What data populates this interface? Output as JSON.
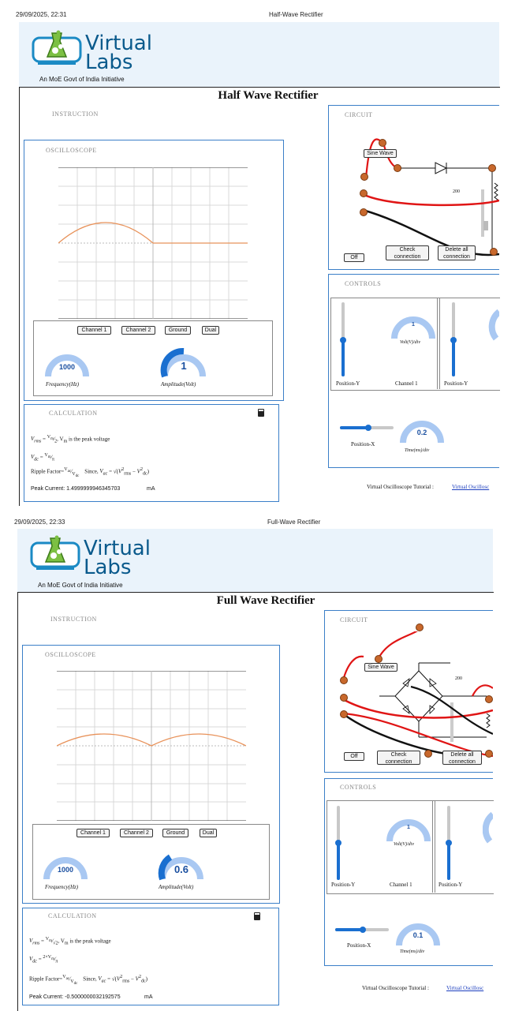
{
  "pages": [
    {
      "header_datetime": "29/09/2025, 22:31",
      "header_title": "Half-Wave Rectifier",
      "logo_line1": "Virtual",
      "logo_line2": "Labs",
      "logo_sub": "An MoE Govt of India Initiative",
      "title": "Half Wave Rectifier",
      "instruction_label": "INSTRUCTION",
      "oscilloscope_label": "OSCILLOSCOPE",
      "channel_buttons": [
        "Channel 1",
        "Channel 2",
        "Ground",
        "Dual"
      ],
      "frequency_value": "1000",
      "frequency_label": "Frequency(Hz)",
      "amplitude_value": "1",
      "amplitude_label": "Amplitude(Volt)",
      "calculation_label": "CALCULATION",
      "vrms_text": ", V",
      "vrms_suffix": " is the peak voltage",
      "ripple_label": "Ripple Factor=",
      "since_text": "Since,",
      "peak_current_label": "Peak Current: 1.4999999946345703",
      "peak_current_unit": "mA",
      "circuit_label": "CIRCUIT",
      "sine_wave_label": "Sine Wave",
      "resistor_value": "200",
      "off_button": "Off",
      "check_button": "Check connection",
      "delete_button": "Delete all connection",
      "controls_label": "CONTROLS",
      "volt_div_value": "1",
      "volt_div_label": "Volt(V)/div",
      "position_y_label": "Position-Y",
      "channel1_label": "Channel 1",
      "position_y2_label": "Position-Y",
      "time_div_value": "0.2",
      "time_div_label": "Time(ms)/div",
      "position_x_label": "Position-X",
      "tutorial_text": "Virtual Oscilloscope Tutorial :",
      "tutorial_link": "Virtual Oscillosc"
    },
    {
      "header_datetime": "29/09/2025, 22:33",
      "header_title": "Full-Wave Rectifier",
      "logo_line1": "Virtual",
      "logo_line2": "Labs",
      "logo_sub": "An MoE Govt of India Initiative",
      "title": "Full Wave Rectifier",
      "instruction_label": "INSTRUCTION",
      "oscilloscope_label": "OSCILLOSCOPE",
      "channel_buttons": [
        "Channel 1",
        "Channel 2",
        "Ground",
        "Dual"
      ],
      "frequency_value": "1000",
      "frequency_label": "Frequency(Hz)",
      "amplitude_value": "0.6",
      "amplitude_label": "Amplitude(Volt)",
      "calculation_label": "CALCULATION",
      "vrms_text": ", V",
      "vrms_suffix": " is the peak voltage",
      "ripple_label": "Ripple Factor=",
      "since_text": "Since,",
      "peak_current_label": "Peak Current: -0.5000000032192575",
      "peak_current_unit": "mA",
      "circuit_label": "CIRCUIT",
      "sine_wave_label": "Sine Wave",
      "resistor_value": "200",
      "off_button": "Off",
      "check_button": "Check connection",
      "delete_button": "Delete all connection",
      "controls_label": "CONTROLS",
      "volt_div_value": "1",
      "volt_div_label": "Volt(V)/div",
      "position_y_label": "Position-Y",
      "channel1_label": "Channel 1",
      "position_y2_label": "Position-Y",
      "time_div_value": "0.1",
      "time_div_label": "Time(ms)/div",
      "position_x_label": "Position-X",
      "tutorial_text": "Virtual Oscilloscope Tutorial :",
      "tutorial_link": "Virtual Oscillosc"
    }
  ],
  "colors": {
    "accent": "#3b7fc8",
    "trace": "#e8925a",
    "knob_blue": "#1a6fd0",
    "gauge_light": "#a9c8f2",
    "wire_red": "#e01515",
    "wire_black": "#111111",
    "banner": "#eaf3fb"
  }
}
